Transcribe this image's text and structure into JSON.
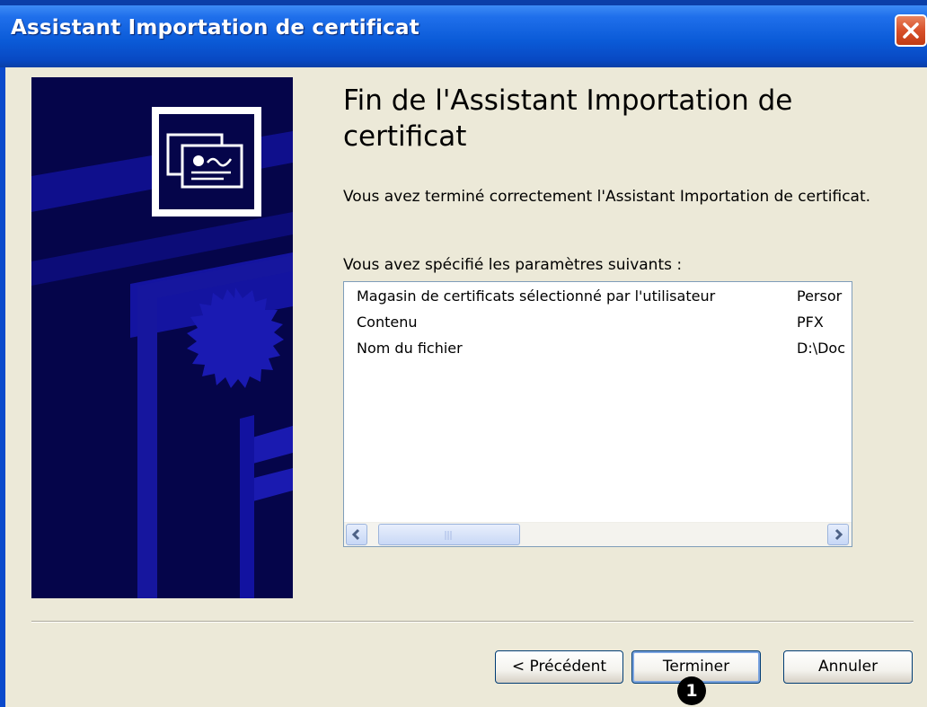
{
  "window": {
    "title": "Assistant Importation de certificat"
  },
  "main": {
    "heading": "Fin de l'Assistant Importation de certificat",
    "intro": "Vous avez terminé correctement l'Assistant Importation de certificat.",
    "params_label": "Vous avez spécifié les paramètres suivants :",
    "settings": [
      {
        "name": "Magasin de certificats sélectionné par l'utilisateur",
        "value": "Persor"
      },
      {
        "name": "Contenu",
        "value": "PFX"
      },
      {
        "name": "Nom du fichier",
        "value": "D:\\Doc"
      }
    ]
  },
  "footer": {
    "back_label": "< Précédent",
    "finish_label": "Terminer",
    "cancel_label": "Annuler"
  },
  "annotation": {
    "badge": "1"
  },
  "icons": {
    "close": "close-icon",
    "banner": "certificate-icon",
    "scroll_left": "arrow-left-icon",
    "scroll_right": "arrow-right-icon"
  },
  "colors": {
    "titlebar": "#0A5FE8",
    "banner_bg": "#05054A",
    "banner_accent": "#1A1AB0",
    "dialog_bg": "#ECE9D8",
    "close_button": "#D8502A"
  }
}
